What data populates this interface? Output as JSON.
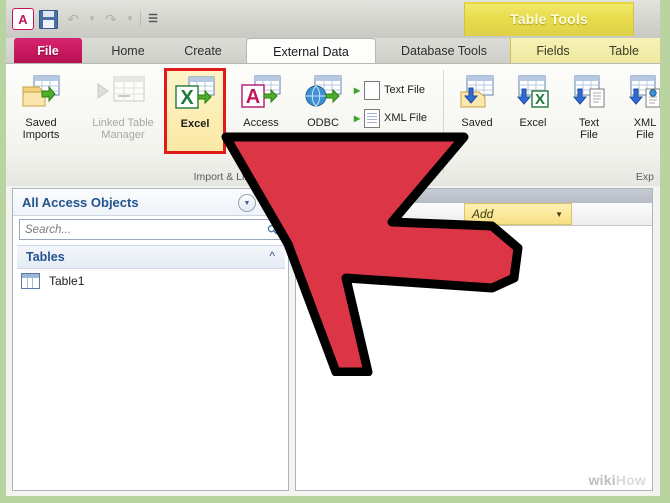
{
  "quick_access": {
    "app_logo": "access-logo",
    "items": [
      {
        "name": "save",
        "icon": "save-icon",
        "enabled": true
      },
      {
        "name": "undo",
        "icon": "undo-arrow-icon",
        "enabled": false
      },
      {
        "name": "redo",
        "icon": "redo-arrow-icon",
        "enabled": false
      },
      {
        "name": "customize",
        "icon": "customize-qat-icon",
        "enabled": true
      }
    ]
  },
  "contextual": {
    "banner_label": "Table Tools"
  },
  "tabs": [
    {
      "id": "file",
      "label": "File",
      "active": false,
      "style": "file"
    },
    {
      "id": "home",
      "label": "Home",
      "active": false,
      "style": "normal"
    },
    {
      "id": "create",
      "label": "Create",
      "active": false,
      "style": "normal"
    },
    {
      "id": "external",
      "label": "External Data",
      "active": true,
      "style": "normal"
    },
    {
      "id": "database",
      "label": "Database Tools",
      "active": false,
      "style": "normal"
    },
    {
      "id": "fields",
      "label": "Fields",
      "active": false,
      "style": "contextual"
    },
    {
      "id": "table",
      "label": "Table",
      "active": false,
      "style": "contextual"
    }
  ],
  "ribbon": {
    "groups": [
      {
        "id": "import-link",
        "label": "Import & Link"
      },
      {
        "id": "export",
        "label": "Exp"
      }
    ],
    "import_buttons": [
      {
        "id": "saved-imports",
        "label": "Saved\nImports",
        "line1": "Saved",
        "line2": "Imports",
        "enabled": true,
        "icon": "saved-imports-icon"
      },
      {
        "id": "linked-table-manager",
        "label": "Linked Table\nManager",
        "line1": "Linked Table",
        "line2": "Manager",
        "enabled": false,
        "icon": "linked-table-manager-icon"
      },
      {
        "id": "excel-import",
        "label": "Excel",
        "line1": "Excel",
        "line2": "",
        "enabled": true,
        "icon": "excel-import-icon",
        "highlighted": true
      },
      {
        "id": "access-import",
        "label": "Access",
        "line1": "Access",
        "line2": "",
        "enabled": true,
        "icon": "access-import-icon"
      },
      {
        "id": "odbc-import",
        "label": "ODBC",
        "line1": "ODBC",
        "line2": "",
        "enabled": true,
        "icon": "odbc-database-icon"
      }
    ],
    "import_small_buttons": [
      {
        "id": "text-file-import",
        "label": "Text File",
        "icon": "text-file-icon"
      },
      {
        "id": "xml-file-import",
        "label": "XML File",
        "icon": "xml-file-icon"
      }
    ],
    "export_buttons": [
      {
        "id": "saved-exports",
        "line1": "Saved",
        "line2": "",
        "icon": "saved-exports-icon"
      },
      {
        "id": "excel-export",
        "line1": "Excel",
        "line2": "",
        "icon": "excel-export-icon"
      },
      {
        "id": "text-export",
        "line1": "Text",
        "line2": "File",
        "icon": "text-file-export-icon"
      },
      {
        "id": "xml-export",
        "line1": "XML",
        "line2": "File",
        "icon": "xml-file-export-icon"
      }
    ]
  },
  "nav_pane": {
    "title": "All Access Objects",
    "dropdown_icon": "chevron-down-circle-icon",
    "collapse_icon": "double-chevron-left-icon",
    "search": {
      "value": "",
      "placeholder": "Search...",
      "icon": "search-icon"
    },
    "group": {
      "label": "Tables",
      "chevron_icon": "double-chevron-up-icon"
    },
    "items": [
      {
        "id": "table1",
        "label": "Table1",
        "icon": "table-icon"
      }
    ]
  },
  "datasheet": {
    "add_column_label": "Add",
    "add_column_caret": "caret-down-icon",
    "new_row_marker": "✱"
  },
  "annotation": {
    "cursor": "red-arrow-cursor",
    "highlight_color": "#e11b1b",
    "cursor_color": "#dc3546"
  },
  "watermark": {
    "wiki": "wiki",
    "how": "How"
  }
}
